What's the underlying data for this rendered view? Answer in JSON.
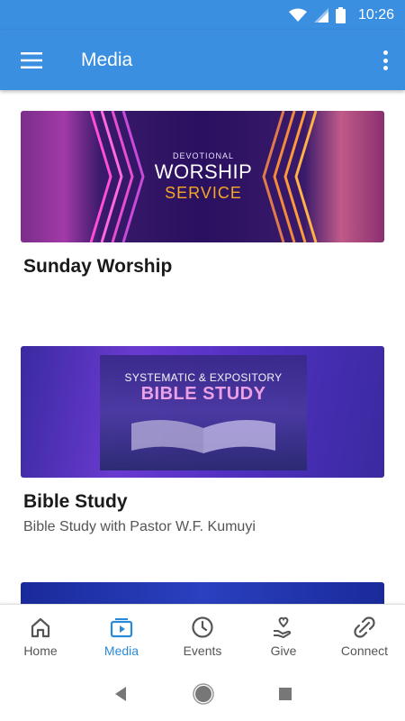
{
  "status_bar": {
    "time": "10:26"
  },
  "app_bar": {
    "title": "Media"
  },
  "cards": [
    {
      "image_lines": [
        "DEVOTIONAL",
        "WORSHIP",
        "SERVICE"
      ],
      "title": "Sunday Worship",
      "subtitle": ""
    },
    {
      "image_lines": [
        "SYSTEMATIC & EXPOSITORY",
        "BIBLE STUDY"
      ],
      "title": "Bible Study",
      "subtitle": "Bible Study with Pastor W.F. Kumuyi"
    }
  ],
  "bottom_nav": {
    "items": [
      {
        "label": "Home",
        "icon": "home-icon",
        "active": false
      },
      {
        "label": "Media",
        "icon": "media-icon",
        "active": true
      },
      {
        "label": "Events",
        "icon": "clock-icon",
        "active": false
      },
      {
        "label": "Give",
        "icon": "give-icon",
        "active": false
      },
      {
        "label": "Connect",
        "icon": "connect-icon",
        "active": false
      }
    ]
  },
  "colors": {
    "primary": "#3a8fe0",
    "active_nav": "#2a8ad8",
    "nav_inactive": "#555555"
  }
}
